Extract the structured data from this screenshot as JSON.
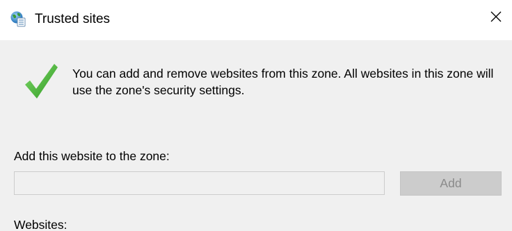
{
  "window": {
    "title": "Trusted sites",
    "title_icon": "trusted-sites-globe-icon",
    "close_icon": "close-icon"
  },
  "info": {
    "icon": "green-check-icon",
    "text": "You can add and remove websites from this zone. All websites in this zone will use the zone's security settings.",
    "icon_color": "#3fae2a"
  },
  "add_section": {
    "label": "Add this website to the zone:",
    "input_value": "",
    "input_placeholder": "",
    "button_label": "Add",
    "button_enabled": false
  },
  "websites_section": {
    "label": "Websites:"
  },
  "colors": {
    "panel_background": "#f0f0f0",
    "titlebar_background": "#ffffff",
    "disabled_button_background": "#cccccc",
    "disabled_button_text": "#8a8a8a"
  }
}
